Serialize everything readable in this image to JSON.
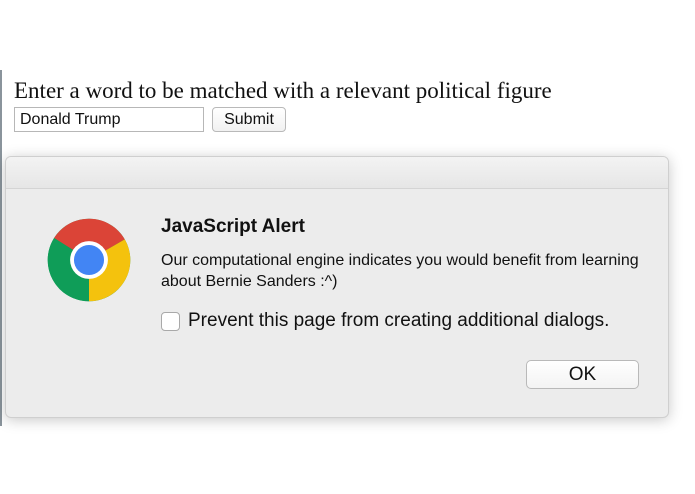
{
  "page": {
    "prompt": "Enter a word to be matched with a relevant political figure",
    "input_value": "Donald Trump",
    "submit_label": "Submit"
  },
  "dialog": {
    "title": "JavaScript Alert",
    "message": "Our computational engine indicates you would benefit from learning about Bernie Sanders :^)",
    "checkbox_label": "Prevent this page from creating additional dialogs.",
    "checkbox_checked": false,
    "ok_label": "OK",
    "icon": "chrome-logo-icon"
  },
  "colors": {
    "chrome_red": "#db4437",
    "chrome_yellow": "#f4c20d",
    "chrome_green": "#0f9d58",
    "chrome_blue": "#4285f4"
  }
}
